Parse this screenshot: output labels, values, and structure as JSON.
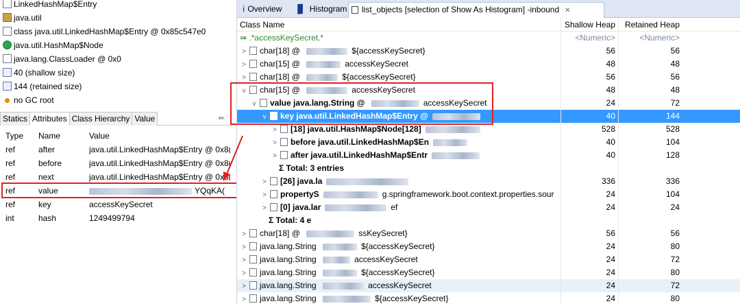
{
  "inspector": {
    "rows": [
      {
        "icon": "file-icon",
        "text": "LinkedHashMap$Entry"
      },
      {
        "icon": "package-icon",
        "text": "java.util"
      },
      {
        "icon": "class-file-icon",
        "text": "class java.util.LinkedHashMap$Entry @ 0x85c547e0"
      },
      {
        "icon": "class-icon",
        "text": "java.util.HashMap$Node"
      },
      {
        "icon": "classloader-icon",
        "text": "java.lang.ClassLoader @ 0x0"
      },
      {
        "icon": "size-icon",
        "text": "40 (shallow size)"
      },
      {
        "icon": "size-icon",
        "text": "144 (retained size)"
      },
      {
        "icon": "gc-root-icon",
        "text": "no GC root"
      }
    ]
  },
  "attr_tabs": [
    "Statics",
    "Attributes",
    "Class Hierarchy",
    "Value"
  ],
  "attr_table": {
    "headers": [
      "Type",
      "Name",
      "Value"
    ],
    "rows": [
      {
        "type": "ref",
        "name": "after",
        "value": "java.util.LinkedHashMap$Entry @ 0x8("
      },
      {
        "type": "ref",
        "name": "before",
        "value": "java.util.LinkedHashMap$Entry @ 0x8("
      },
      {
        "type": "ref",
        "name": "next",
        "value": "java.util.LinkedHashMap$Entry @ 0x8("
      },
      {
        "type": "ref",
        "name": "value",
        "value": "YQqKA("
      },
      {
        "type": "ref",
        "name": "key",
        "value": "accessKeySecret"
      },
      {
        "type": "int",
        "name": "hash",
        "value": "1249499794"
      }
    ]
  },
  "editor_tabs": [
    {
      "label": "Overview",
      "icon": "info-icon"
    },
    {
      "label": "Histogram",
      "icon": "histogram-icon"
    },
    {
      "label": "list_objects  [selection of Show As Histogram] -inbound",
      "icon": "list-icon"
    }
  ],
  "close_glyph": "✕",
  "grid": {
    "headers": {
      "name": "Class Name",
      "shallow": "Shallow Heap",
      "retained": "Retained Heap"
    },
    "filter": {
      "name": ".*accessKeySecret.*",
      "shallow": "<Numeric>",
      "retained": "<Numeric>"
    },
    "rows": [
      {
        "indent": 0,
        "tw": ">",
        "pre": "char[18] @ ",
        "post": "${accessKeySecret}",
        "shallow": "56",
        "retained": "56",
        "bold": false
      },
      {
        "indent": 0,
        "tw": ">",
        "pre": "char[15] @ ",
        "post": "accessKeySecret",
        "shallow": "48",
        "retained": "48",
        "bold": false
      },
      {
        "indent": 0,
        "tw": ">",
        "pre": "char[18] @ ",
        "post": "${accessKeySecret}",
        "shallow": "56",
        "retained": "56",
        "bold": false
      },
      {
        "indent": 0,
        "tw": "v",
        "pre": "char[15] @ ",
        "post": "accessKeySecret",
        "shallow": "48",
        "retained": "48",
        "bold": false
      },
      {
        "indent": 1,
        "tw": "v",
        "pre": "value java.lang.String @ ",
        "post": "accessKeySecret",
        "shallow": "24",
        "retained": "72",
        "bold": true
      },
      {
        "indent": 2,
        "tw": "v",
        "pre": "key java.util.LinkedHashMap$Entry @",
        "post": "",
        "shallow": "40",
        "retained": "144",
        "bold": true,
        "sel": true
      },
      {
        "indent": 3,
        "tw": ">",
        "pre": "[18] java.util.HashMap$Node[128]",
        "post": "",
        "shallow": "528",
        "retained": "528",
        "bold": true
      },
      {
        "indent": 3,
        "tw": ">",
        "pre": "before java.util.LinkedHashMap$En",
        "post": "",
        "shallow": "40",
        "retained": "104",
        "bold": true
      },
      {
        "indent": 3,
        "tw": ">",
        "pre": "after java.util.LinkedHashMap$Entr",
        "post": "",
        "shallow": "40",
        "retained": "128",
        "bold": true
      },
      {
        "indent": 3,
        "tw": "",
        "pre": "Σ Total: 3 entries",
        "post": "",
        "shallow": "",
        "retained": "",
        "bold": true,
        "total": true
      },
      {
        "indent": 2,
        "tw": ">",
        "pre": "[26] java.la",
        "post": "",
        "shallow": "336",
        "retained": "336",
        "bold": true
      },
      {
        "indent": 2,
        "tw": ">",
        "pre": "propertyS",
        "post": "g.springframework.boot.context.properties.sour",
        "shallow": "24",
        "retained": "104",
        "bold": true
      },
      {
        "indent": 2,
        "tw": ">",
        "pre": "[0] java.lar",
        "post": "ef",
        "shallow": "24",
        "retained": "24",
        "bold": true
      },
      {
        "indent": 2,
        "tw": "",
        "pre": "Σ Total: 4 e",
        "post": "",
        "shallow": "",
        "retained": "",
        "bold": true,
        "total": true
      },
      {
        "indent": 0,
        "tw": ">",
        "pre": "char[18] @ ",
        "post": "ssKeySecret}",
        "shallow": "56",
        "retained": "56",
        "bold": false
      },
      {
        "indent": 0,
        "tw": ">",
        "pre": "java.lang.String ",
        "post": "${accessKeySecret}",
        "shallow": "24",
        "retained": "80",
        "bold": false
      },
      {
        "indent": 0,
        "tw": ">",
        "pre": "java.lang.String ",
        "post": "accessKeySecret",
        "shallow": "24",
        "retained": "72",
        "bold": false
      },
      {
        "indent": 0,
        "tw": ">",
        "pre": "java.lang.String ",
        "post": "${accessKeySecret}",
        "shallow": "24",
        "retained": "80",
        "bold": false
      },
      {
        "indent": 0,
        "tw": ">",
        "pre": "java.lang.String ",
        "post": "accessKeySecret",
        "shallow": "24",
        "retained": "72",
        "bold": false,
        "alt": true
      },
      {
        "indent": 0,
        "tw": ">",
        "pre": "java.lang.String ",
        "post": "${accessKeySecret}",
        "shallow": "24",
        "retained": "80",
        "bold": false
      }
    ]
  }
}
